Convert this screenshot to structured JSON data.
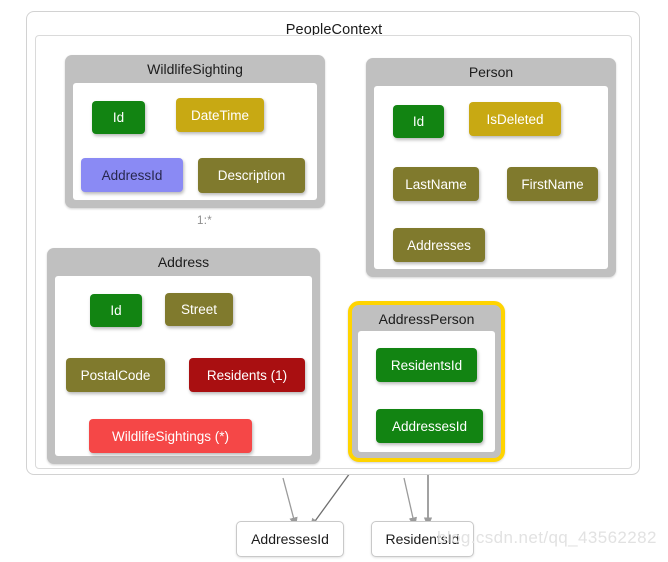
{
  "context": {
    "title": "PeopleContext"
  },
  "entities": [
    {
      "id": "wildlife-sighting",
      "name": "WildlifeSighting",
      "highlighted": false,
      "properties": [
        {
          "label": "Id",
          "kind": "key"
        },
        {
          "label": "DateTime",
          "kind": "gold"
        },
        {
          "label": "AddressId",
          "kind": "lilac"
        },
        {
          "label": "Description",
          "kind": "olive"
        }
      ]
    },
    {
      "id": "person",
      "name": "Person",
      "highlighted": false,
      "properties": [
        {
          "label": "Id",
          "kind": "key"
        },
        {
          "label": "IsDeleted",
          "kind": "gold"
        },
        {
          "label": "LastName",
          "kind": "olive"
        },
        {
          "label": "FirstName",
          "kind": "olive"
        },
        {
          "label": "Addresses",
          "kind": "olive"
        }
      ]
    },
    {
      "id": "address",
      "name": "Address",
      "highlighted": false,
      "properties": [
        {
          "label": "Id",
          "kind": "key"
        },
        {
          "label": "Street",
          "kind": "olive"
        },
        {
          "label": "PostalCode",
          "kind": "olive"
        },
        {
          "label": "Residents (1)",
          "kind": "darkred"
        },
        {
          "label": "WildlifeSightings (*)",
          "kind": "brightred"
        }
      ]
    },
    {
      "id": "address-person",
      "name": "AddressPerson",
      "highlighted": true,
      "properties": [
        {
          "label": "ResidentsId",
          "kind": "key"
        },
        {
          "label": "AddressesId",
          "kind": "key"
        }
      ]
    }
  ],
  "leaf_nodes": [
    {
      "id": "addresses-id",
      "label": "AddressesId"
    },
    {
      "id": "residents-id",
      "label": "ResidentsId"
    }
  ],
  "edges": [
    {
      "id": "wildlife-to-address",
      "label": "1:*",
      "from": "wildlife-sighting",
      "to": "address"
    },
    {
      "id": "address-to-addresses-id",
      "label": "",
      "from": "address",
      "to": "addresses-id"
    },
    {
      "id": "addressperson-to-addresses-id",
      "label": "",
      "from": "address-person",
      "to": "addresses-id"
    },
    {
      "id": "address-to-residents-id",
      "label": "",
      "from": "address-person",
      "to": "residents-id"
    },
    {
      "id": "addressperson-to-residents-id",
      "label": "",
      "from": "address-person",
      "to": "residents-id"
    }
  ],
  "watermark": {
    "text": "blog.csdn.net/qq_43562282"
  },
  "colors": {
    "key": "#128412",
    "gold": "#c8a913",
    "olive": "#807a2d",
    "lilac": "#8a8af4",
    "darkred": "#a90f11",
    "brightred": "#f54747",
    "entity_header": "#c0c0c0",
    "highlight_border": "#ffd400",
    "edge": "#8d8d8d"
  }
}
